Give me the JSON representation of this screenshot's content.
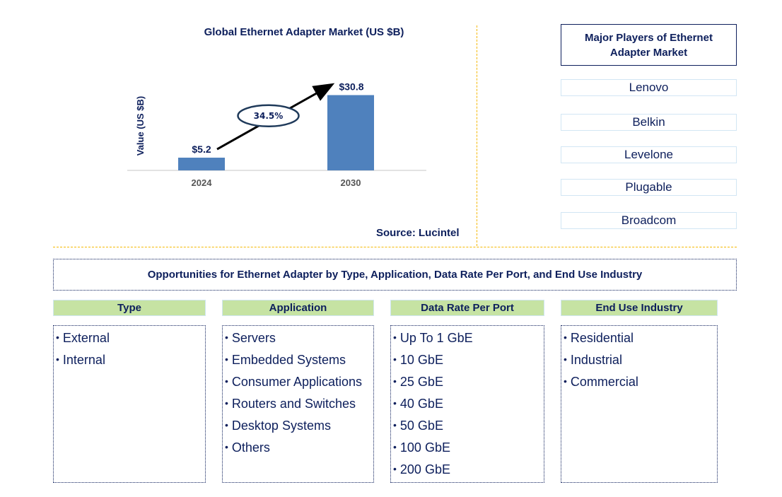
{
  "chart_data": {
    "type": "bar",
    "title": "Global Ethernet Adapter Market (US $B)",
    "xlabel": "",
    "ylabel": "Value (US $B)",
    "categories": [
      "2024",
      "2030"
    ],
    "values": [
      5.2,
      30.8
    ],
    "data_labels": [
      "$5.2",
      "$30.8"
    ],
    "ylim": [
      0,
      35
    ],
    "grid": false,
    "annotation": {
      "type": "growth-arrow",
      "label": "34.5%",
      "from": "2024",
      "to": "2030"
    },
    "bar_color": "#4f81bd"
  },
  "source": "Source: Lucintel",
  "players": {
    "title": "Major Players of Ethernet Adapter Market",
    "items": [
      "Lenovo",
      "Belkin",
      "Levelone",
      "Plugable",
      "Broadcom"
    ]
  },
  "opportunities": {
    "title": "Opportunities for Ethernet Adapter by Type, Application, Data Rate Per Port, and End Use Industry",
    "categories": [
      {
        "label": "Type",
        "items": [
          "External",
          "Internal"
        ]
      },
      {
        "label": "Application",
        "items": [
          "Servers",
          "Embedded Systems",
          "Consumer Applications",
          "Routers and Switches",
          "Desktop Systems",
          "Others"
        ]
      },
      {
        "label": "Data Rate Per Port",
        "items": [
          "Up To 1 GbE",
          "10 GbE",
          "25 GbE",
          "40 GbE",
          "50 GbE",
          "100 GbE",
          "200 GbE"
        ]
      },
      {
        "label": "End Use Industry",
        "items": [
          "Residential",
          "Industrial",
          "Commercial"
        ]
      }
    ]
  },
  "colors": {
    "navy": "#0d1f5c",
    "bar": "#4f81bd",
    "header_green": "#c6e3a3",
    "divider": "#f5b800"
  }
}
